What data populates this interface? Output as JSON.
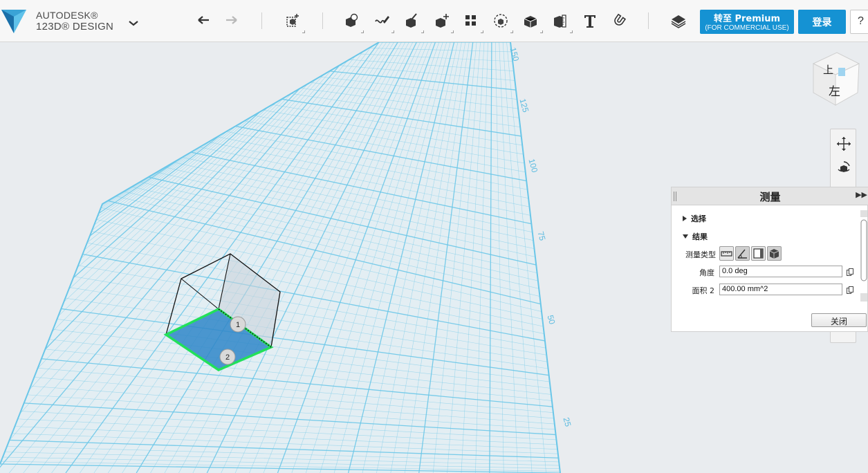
{
  "app": {
    "brand_line1": "AUTODESK®",
    "brand_line2": "123D® DESIGN"
  },
  "toolbar": {
    "icons": [
      "undo-icon",
      "redo-icon",
      "transform-icon",
      "primitives-icon",
      "sketch-icon",
      "construct-icon",
      "modify-icon",
      "pattern-icon",
      "group-icon",
      "combine-icon",
      "measure-icon",
      "text-icon",
      "snap-icon",
      "materials-icon"
    ],
    "premium_line1": "转至 Premium",
    "premium_line2": "(FOR COMMERCIAL USE)",
    "login_label": "登录",
    "help_label": "?"
  },
  "viewport": {
    "ruler_labels": [
      "150",
      "125",
      "100",
      "75",
      "50",
      "25"
    ],
    "markers": [
      "1",
      "2"
    ],
    "viewcube_faces": [
      "上",
      "左"
    ],
    "colors": {
      "grid": "#6ac6e8",
      "selection": "#22e05a",
      "face": "#2f86c8"
    }
  },
  "measure_panel": {
    "title": "测量",
    "section_select": "选择",
    "section_result": "结果",
    "type_label": "测量类型",
    "angle_label": "角度",
    "angle_value": "0.0 deg",
    "area_label": "面积 2",
    "area_value": "400.00 mm^2",
    "close_label": "关闭"
  }
}
